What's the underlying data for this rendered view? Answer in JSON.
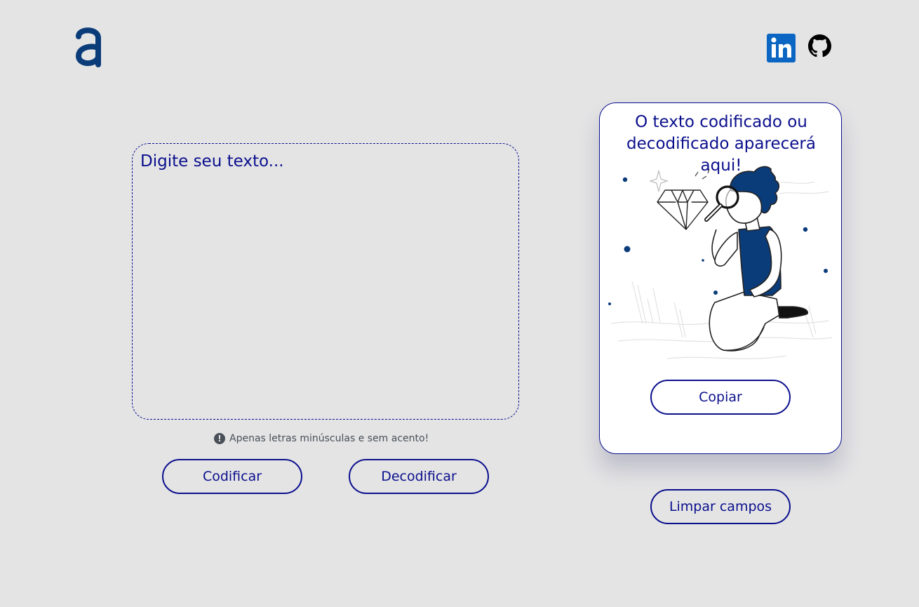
{
  "header": {
    "logo_icon": "alura-a-logo-icon",
    "logo_color": "#0b3c7a",
    "social": [
      {
        "name": "linkedin-icon",
        "color": "#0a66c2"
      },
      {
        "name": "github-icon",
        "color": "#000000"
      }
    ]
  },
  "input": {
    "placeholder": "Digite seu texto...",
    "value": ""
  },
  "hint": {
    "icon": "exclamation-circle-icon",
    "text": "Apenas letras minúsculas e sem acento!"
  },
  "buttons": {
    "encode_label": "Codificar",
    "decode_label": "Decodificar",
    "clear_label": "Limpar campos"
  },
  "output": {
    "message": "O texto codificado ou decodificado aparecerá aqui!",
    "illustration": "person-with-magnifying-glass-diamond-illustration",
    "copy_label": "Copiar"
  },
  "colors": {
    "background": "#e4e4e5",
    "accent": "#0a0f8c",
    "card_background": "#ffffff",
    "illustration_blue": "#0b3c7a"
  }
}
